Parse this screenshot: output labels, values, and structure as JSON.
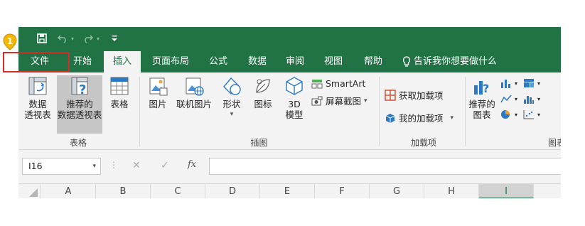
{
  "qat": {
    "save_icon": "save-icon",
    "undo_icon": "undo-icon",
    "redo_icon": "redo-icon",
    "customize_icon": "customize-qat-icon"
  },
  "tabs": [
    {
      "label": "文件"
    },
    {
      "label": "开始"
    },
    {
      "label": "插入",
      "active": true
    },
    {
      "label": "页面布局"
    },
    {
      "label": "公式"
    },
    {
      "label": "数据"
    },
    {
      "label": "审阅"
    },
    {
      "label": "视图"
    },
    {
      "label": "帮助"
    }
  ],
  "tell_me": "告诉我你想要做什么",
  "ribbon": {
    "pivot_table": "数据\n透视表",
    "recommended_pivot": "推荐的\n数据透视表",
    "table": "表格",
    "group_tables": "表格",
    "pictures": "图片",
    "online_pictures": "联机图片",
    "shapes": "形状",
    "icons": "图标",
    "model3d": "3D\n模型",
    "smartart": "SmartArt",
    "screenshot": "屏幕截图",
    "group_illustrations": "插图",
    "get_addins": "获取加载项",
    "my_addins": "我的加载项",
    "group_addins": "加载项",
    "recommended_charts": "推荐的\n图表",
    "group_charts": "图表"
  },
  "formula_bar": {
    "name_box": "I16",
    "fx": "fx",
    "cancel": "✕",
    "enter": "✓",
    "formula": ""
  },
  "columns": [
    "A",
    "B",
    "C",
    "D",
    "E",
    "F",
    "G",
    "H",
    "I"
  ],
  "selected_column": "I",
  "annotation": {
    "marker": "1"
  },
  "colors": {
    "excel_green": "#217346",
    "highlight_red": "#d62b2b",
    "marker_yellow": "#f2b705"
  }
}
